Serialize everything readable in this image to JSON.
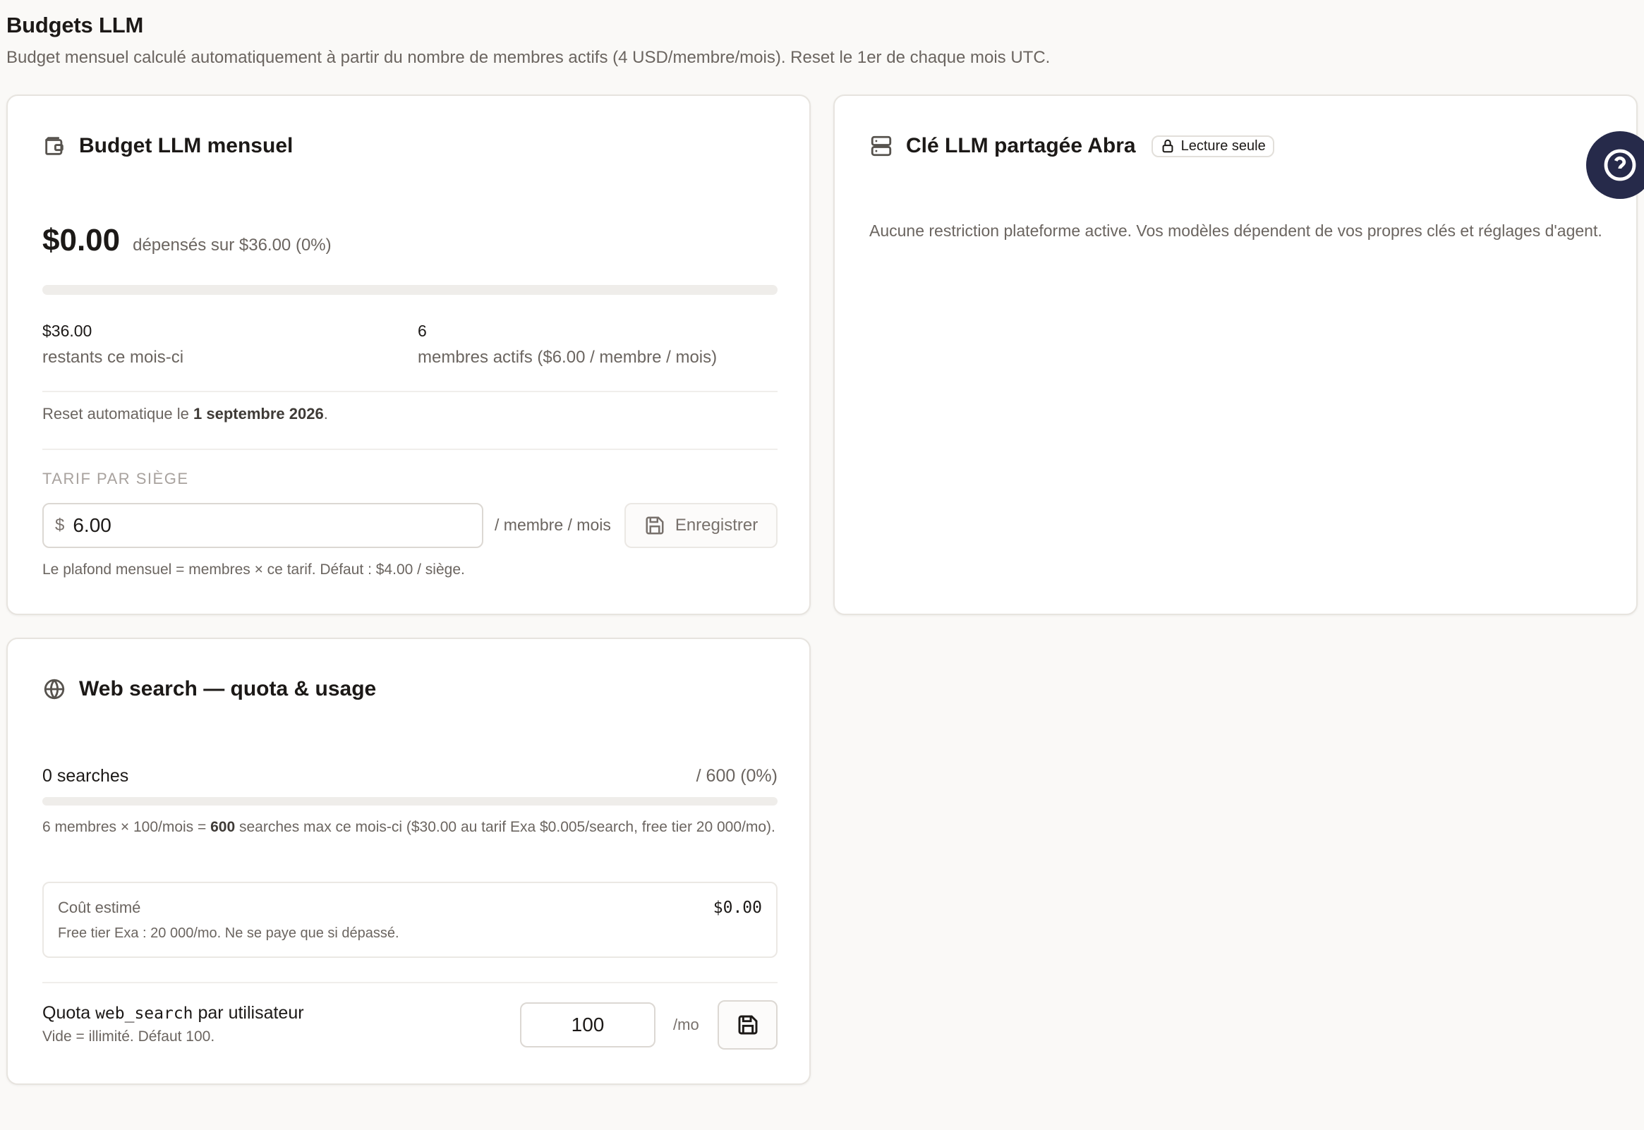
{
  "header": {
    "title": "Budgets LLM",
    "subtitle": "Budget mensuel calculé automatiquement à partir du nombre de membres actifs (4 USD/membre/mois). Reset le 1er de chaque mois UTC."
  },
  "budget": {
    "title": "Budget LLM mensuel",
    "icon": "wallet-icon",
    "spent": "$0.00",
    "spent_sub": "dépensés sur $36.00 (0%)",
    "progress_percent": 0,
    "remaining_value": "$36.00",
    "remaining_label": "restants ce mois-ci",
    "members_value": "6",
    "members_label": "membres actifs ($6.00 / membre / mois)",
    "reset_prefix": "Reset automatique le ",
    "reset_date": "1 septembre 2026",
    "reset_suffix": ".",
    "seat_section_label": "TARIF PAR SIÈGE",
    "currency_symbol": "$",
    "seat_price_value": "6.00",
    "per_unit": "/ membre / mois",
    "save_label": "Enregistrer",
    "hint": "Le plafond mensuel = membres × ce tarif. Défaut : $4.00 / siège."
  },
  "shared_key": {
    "title": "Clé LLM partagée Abra",
    "icon": "server-icon",
    "badge": "Lecture seule",
    "text": "Aucune restriction plateforme active. Vos modèles dépendent de vos propres clés et réglages d'agent."
  },
  "web_search": {
    "title": "Web search — quota & usage",
    "icon": "globe-icon",
    "count": "0 searches",
    "total": "/ 600 (0%)",
    "progress_percent": 0,
    "desc_prefix": "6 membres × 100/mois = ",
    "desc_bold": "600",
    "desc_suffix": " searches max ce mois-ci ($30.00 au tarif Exa $0.005/search, free tier 20 000/mo).",
    "cost_label": "Coût estimé",
    "cost_note": "Free tier Exa : 20 000/mo. Ne se paye que si dépassé.",
    "cost_value": "$0.00",
    "quota_label_prefix": "Quota ",
    "quota_label_code": "web_search",
    "quota_label_suffix": " par utilisateur",
    "quota_hint": "Vide = illimité. Défaut 100.",
    "quota_value": "100",
    "quota_unit": "/mo"
  },
  "help": {
    "icon": "help-circle-icon"
  },
  "colors": {
    "accent": "#262a4a",
    "progress_track": "#efedea"
  }
}
